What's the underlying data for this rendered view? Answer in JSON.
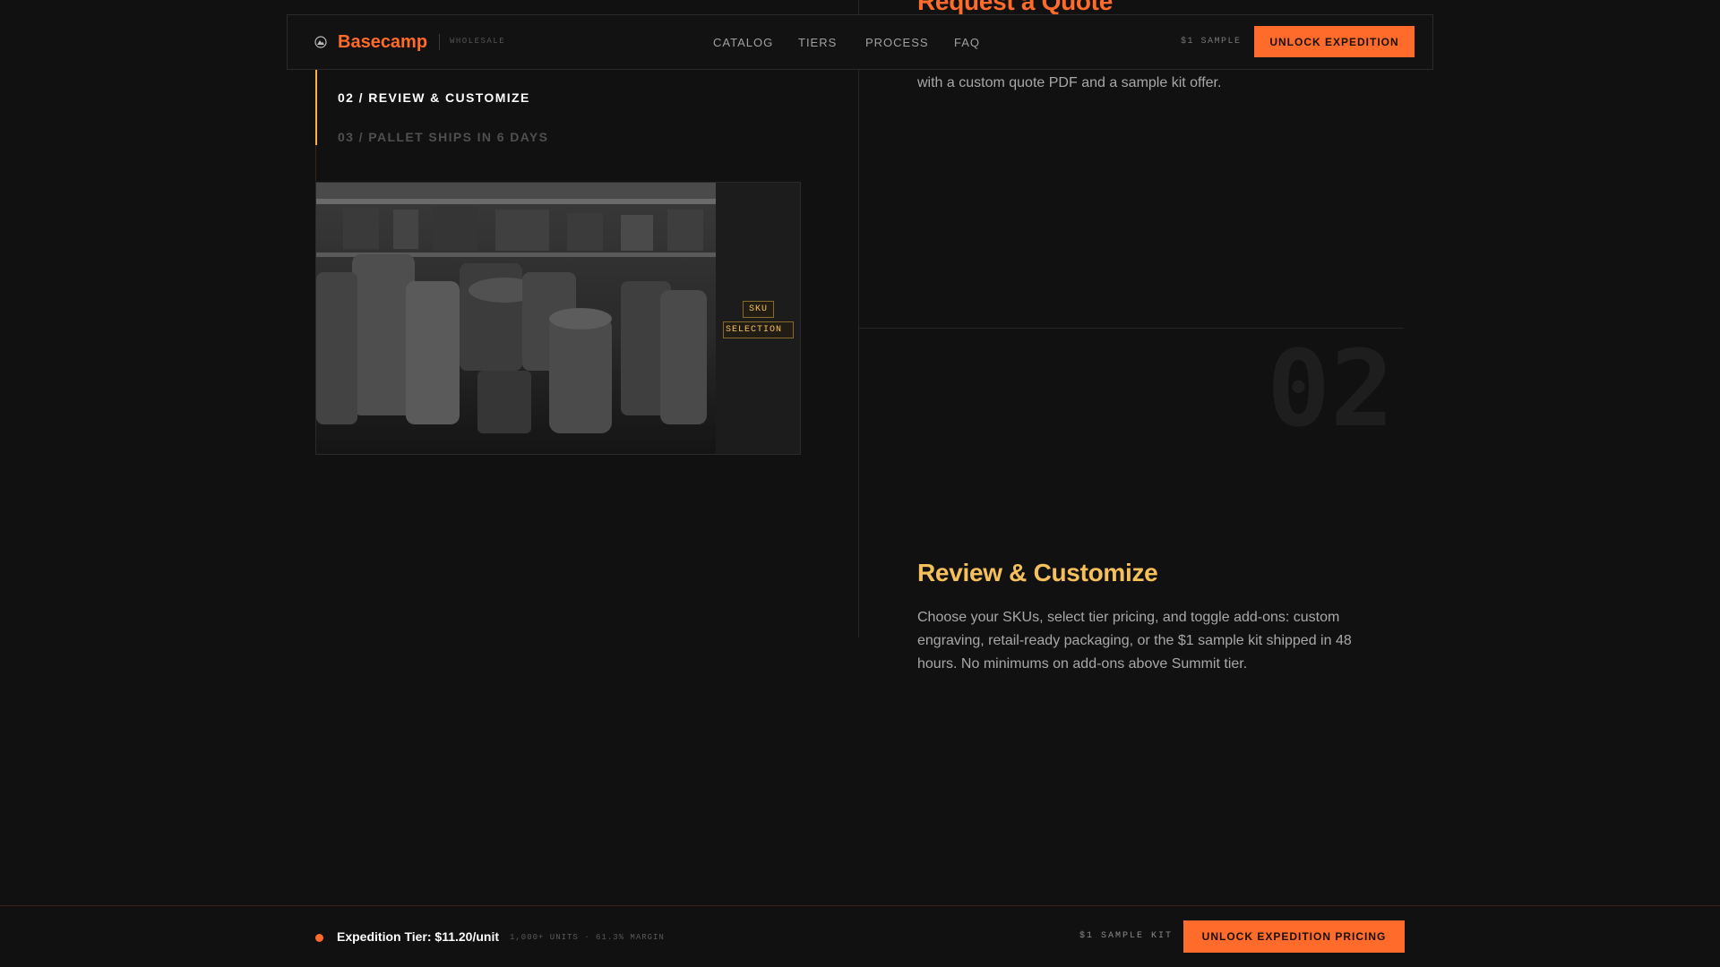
{
  "nav": {
    "brand": "Basecamp",
    "brand_sub": "WHOLESALE",
    "links": [
      "CATALOG",
      "TIERS",
      "PROCESS",
      "FAQ"
    ],
    "sample_label": "$1 SAMPLE",
    "cta_label": "UNLOCK EXPEDITION"
  },
  "progress": {
    "items": [
      "02 / REVIEW & CUSTOMIZE",
      "03 / PALLET SHIPS IN 6 DAYS"
    ],
    "active_index": 0
  },
  "card": {
    "tag_lines": [
      "SKU",
      "SELECTION"
    ]
  },
  "steps": {
    "previous": {
      "heading": "Request a Quote",
      "desc_tail": "with a custom quote PDF and a sample kit offer."
    },
    "current": {
      "number": "02",
      "heading": "Review & Customize",
      "desc": "Choose your SKUs, select tier pricing, and toggle add-ons: custom engraving, retail-ready packaging, or the $1 sample kit shipped in 48 hours. No minimums on add-ons above Summit tier."
    }
  },
  "bottom_bar": {
    "tier_label": "Expedition Tier: $11.20/unit",
    "meta": "1,000+ UNITS · 61.3% MARGIN",
    "sample_label": "$1 SAMPLE KIT",
    "cta_label": "UNLOCK EXPEDITION PRICING"
  },
  "colors": {
    "background": "#111111",
    "accent": "#ff6b2b",
    "highlight": "#f5c05a",
    "muted": "#a8a8a8"
  }
}
